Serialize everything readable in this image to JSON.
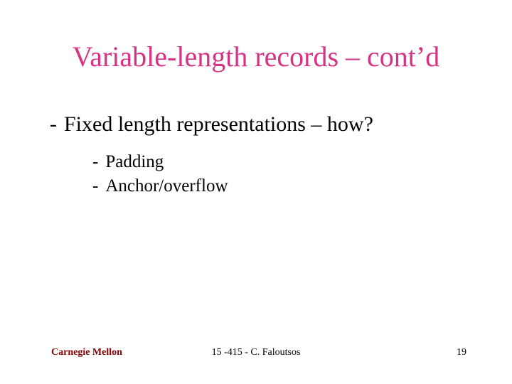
{
  "slide": {
    "title": "Variable-length records – cont’d",
    "bullets": {
      "l1": {
        "dash": "-",
        "text": "Fixed length representations – how?"
      },
      "l2": [
        {
          "dash": "-",
          "text": "Padding"
        },
        {
          "dash": "-",
          "text": "Anchor/overflow"
        }
      ]
    },
    "footer": {
      "left": "Carnegie Mellon",
      "center": "15 -415 - C. Faloutsos",
      "right": "19"
    }
  }
}
